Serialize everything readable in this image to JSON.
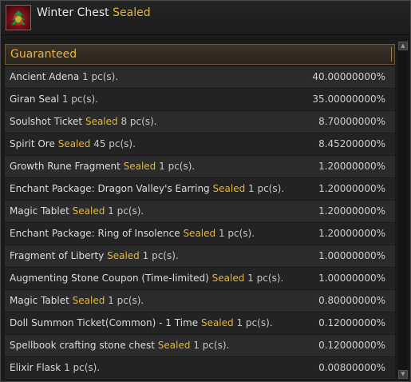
{
  "header": {
    "title": "Winter Chest",
    "title_tag": "Sealed",
    "icon": "winter-chest-icon"
  },
  "section": {
    "label": "Guaranteed"
  },
  "items": [
    {
      "name": "Ancient Adena",
      "tag": "",
      "qty": "1 pc(s).",
      "chance": "40.00000000%"
    },
    {
      "name": "Giran Seal",
      "tag": "",
      "qty": "1 pc(s).",
      "chance": "35.00000000%"
    },
    {
      "name": "Soulshot Ticket",
      "tag": "Sealed",
      "qty": "8 pc(s).",
      "chance": "8.70000000%"
    },
    {
      "name": "Spirit Ore",
      "tag": "Sealed",
      "qty": "45 pc(s).",
      "chance": "8.45200000%"
    },
    {
      "name": "Growth Rune Fragment",
      "tag": "Sealed",
      "qty": "1 pc(s).",
      "chance": "1.20000000%"
    },
    {
      "name": "Enchant Package: Dragon Valley's Earring",
      "tag": "Sealed",
      "qty": "1 pc(s).",
      "chance": "1.20000000%"
    },
    {
      "name": "Magic Tablet",
      "tag": "Sealed",
      "qty": "1 pc(s).",
      "chance": "1.20000000%"
    },
    {
      "name": "Enchant Package: Ring of Insolence",
      "tag": "Sealed",
      "qty": "1 pc(s).",
      "chance": "1.20000000%"
    },
    {
      "name": "Fragment of Liberty",
      "tag": "Sealed",
      "qty": "1 pc(s).",
      "chance": "1.00000000%"
    },
    {
      "name": "Augmenting Stone Coupon (Time-limited)",
      "tag": "Sealed",
      "qty": "1 pc(s).",
      "chance": "1.00000000%"
    },
    {
      "name": "Magic Tablet",
      "tag": "Sealed",
      "qty": "1 pc(s).",
      "chance": "0.80000000%"
    },
    {
      "name": "Doll Summon Ticket(Common) - 1 Time",
      "tag": "Sealed",
      "qty": "1 pc(s).",
      "chance": "0.12000000%"
    },
    {
      "name": "Spellbook crafting stone chest",
      "tag": "Sealed",
      "qty": "1 pc(s).",
      "chance": "0.12000000%"
    },
    {
      "name": "Elixir Flask",
      "tag": "",
      "qty": "1 pc(s).",
      "chance": "0.00800000%"
    }
  ],
  "colors": {
    "sealed": "#e6b830",
    "section": "#e8b445",
    "row_odd": "#2b2b2b",
    "row_even": "#232323"
  }
}
